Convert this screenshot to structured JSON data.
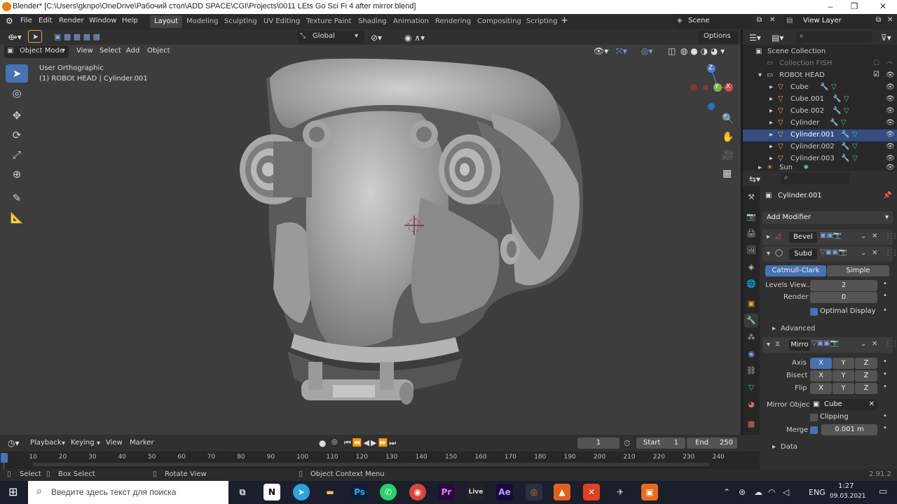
{
  "window": {
    "title": "Blender* [C:\\Users\\gknpo\\OneDrive\\Рабочий стол\\ADD SPACE\\CGI\\Projects\\0011 LEts Go Sci Fi 4 after mirror.blend]"
  },
  "menu": [
    "File",
    "Edit",
    "Render",
    "Window",
    "Help"
  ],
  "workspaces": [
    "Layout",
    "Modeling",
    "Sculpting",
    "UV Editing",
    "Texture Paint",
    "Shading",
    "Animation",
    "Rendering",
    "Compositing",
    "Scripting"
  ],
  "active_workspace": "Layout",
  "scene": "Scene",
  "view_layer": "View Layer",
  "viewport": {
    "mode": "Object Mode",
    "menus": [
      "View",
      "Select",
      "Add",
      "Object"
    ],
    "transform_orientation": "Global",
    "options": "Options",
    "view_name": "User Orthographic",
    "active_info": "(1) ROBOt HEAD | Cylinder.001",
    "gizmo_axes": [
      "Z",
      "Y",
      "X"
    ]
  },
  "outliner": {
    "root": "Scene Collection",
    "items": [
      {
        "label": "Collection FISH",
        "dim": true
      },
      {
        "label": "ROBOt HEAD"
      },
      {
        "label": "Cube"
      },
      {
        "label": "Cube.001"
      },
      {
        "label": "Cube.002"
      },
      {
        "label": "Cylinder"
      },
      {
        "label": "Cylinder.001",
        "selected": true
      },
      {
        "label": "Cylinder.002"
      },
      {
        "label": "Cylinder.003"
      },
      {
        "label": "Sun"
      }
    ]
  },
  "properties": {
    "object_name": "Cylinder.001",
    "add_modifier": "Add Modifier",
    "bevel": {
      "name": "Bevel"
    },
    "subd": {
      "name": "Subd",
      "algorithms": [
        "Catmull-Clark",
        "Simple"
      ],
      "levels_label": "Levels View...",
      "levels_value": "2",
      "render_label": "Render",
      "render_value": "0",
      "optimal_display": "Optimal Display",
      "advanced": "Advanced"
    },
    "mirror": {
      "name": "Mirro",
      "axis_label": "Axis",
      "bisect_label": "Bisect",
      "flip_label": "Flip",
      "xyz": [
        "X",
        "Y",
        "Z"
      ],
      "mirror_object_label": "Mirror Object",
      "mirror_object_value": "Cube",
      "clipping": "Clipping",
      "merge_label": "Merge",
      "merge_value": "0.001 m",
      "data": "Data"
    }
  },
  "timeline": {
    "menus": [
      "Playback",
      "Keying",
      "View",
      "Marker"
    ],
    "current_frame": "1",
    "start_label": "Start",
    "start_value": "1",
    "end_label": "End",
    "end_value": "250",
    "ticks": [
      "0",
      "10",
      "20",
      "30",
      "40",
      "50",
      "60",
      "70",
      "80",
      "90",
      "100",
      "110",
      "120",
      "130",
      "140",
      "150",
      "160",
      "170",
      "180",
      "190",
      "200",
      "210",
      "220",
      "230",
      "240"
    ]
  },
  "status": {
    "select": "Select",
    "box_select": "Box Select",
    "rotate_view": "Rotate View",
    "context_menu": "Object Context Menu",
    "version": "2.91.2"
  },
  "taskbar": {
    "search_placeholder": "Введите здесь текст для поиска",
    "apps": [
      "N",
      "Ps",
      "Pr",
      "Live",
      "Ae"
    ],
    "lang": "ENG",
    "time": "1:27",
    "date": "09.03.2021"
  },
  "colors": {
    "accent": "#4772b3",
    "select": "#334d80",
    "brand": "#e87d0d"
  }
}
